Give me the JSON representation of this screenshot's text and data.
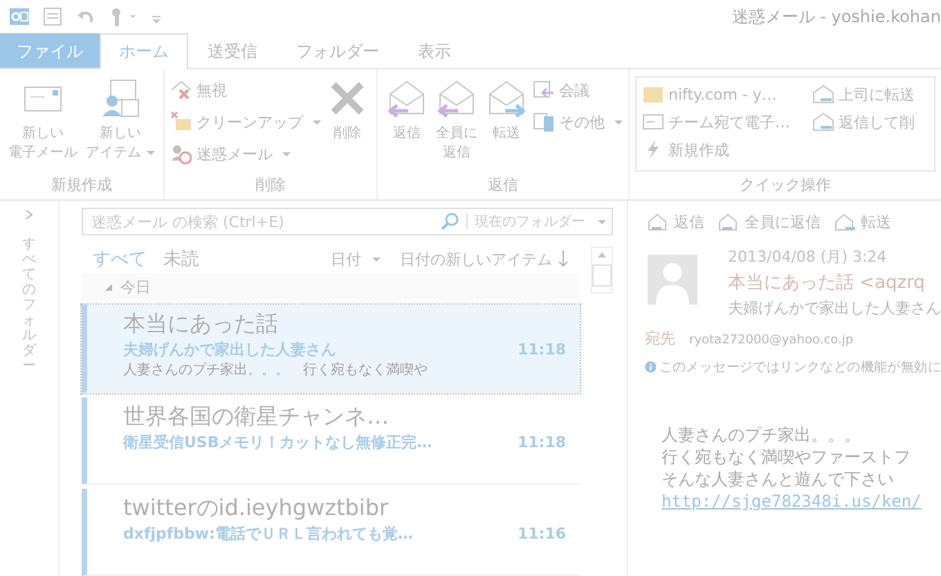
{
  "title_bar": {
    "title": "迷惑メール - yoshie.kohan"
  },
  "tabs": [
    {
      "label": "ファイル",
      "kind": "file",
      "selected": false
    },
    {
      "label": "ホーム",
      "kind": "tab",
      "selected": true
    },
    {
      "label": "送受信",
      "kind": "tab",
      "selected": false
    },
    {
      "label": "フォルダー",
      "kind": "tab",
      "selected": false
    },
    {
      "label": "表示",
      "kind": "tab",
      "selected": false
    }
  ],
  "ribbon": [
    {
      "label": "新規作成",
      "items": [
        {
          "kind": "large",
          "lines": [
            "新しい",
            "電子メール"
          ],
          "dropdown": false
        },
        {
          "kind": "large",
          "lines": [
            "新しい",
            "アイテム"
          ],
          "dropdown": true
        }
      ]
    },
    {
      "label": "削除",
      "items": [
        {
          "kind": "stack",
          "buttons": [
            {
              "label": "無視",
              "dropdown": false
            },
            {
              "label": "クリーンアップ",
              "dropdown": true
            },
            {
              "label": "迷惑メール",
              "dropdown": true
            }
          ]
        },
        {
          "kind": "large",
          "lines": [
            "削除"
          ],
          "dropdown": false
        }
      ]
    },
    {
      "label": "返信",
      "items": [
        {
          "kind": "large",
          "lines": [
            "返信"
          ],
          "dropdown": false
        },
        {
          "kind": "large",
          "lines": [
            "全員に",
            "返信"
          ],
          "dropdown": false
        },
        {
          "kind": "large",
          "lines": [
            "転送"
          ],
          "dropdown": false
        },
        {
          "kind": "stack",
          "buttons": [
            {
              "label": "会議",
              "dropdown": false
            },
            {
              "label": "その他",
              "dropdown": true
            }
          ]
        }
      ]
    },
    {
      "label": "クイック操作",
      "items": [
        {
          "kind": "gallery",
          "buttons": [
            {
              "label": "nifty.com - y…",
              "dropdown": false
            },
            {
              "label": "チーム宛て電子…",
              "dropdown": false
            },
            {
              "label": "新規作成",
              "dropdown": false
            },
            {
              "label": "上司に転送",
              "dropdown": false
            },
            {
              "label": "返信して削",
              "dropdown": false
            }
          ]
        }
      ]
    }
  ],
  "folder_pane": {
    "label": "すべてのフォルダー"
  },
  "search": {
    "placeholder": "迷惑メール の検索 (Ctrl+E)",
    "scope": "現在のフォルダー"
  },
  "filters": [
    {
      "label": "すべて",
      "selected": true
    },
    {
      "label": "未読",
      "selected": false
    }
  ],
  "sort": {
    "field": "日付",
    "order": "日付の新しいアイテム"
  },
  "group_header": "今日",
  "messages": [
    {
      "subject": "本当にあった話",
      "sender": "夫婦げんかで家出した人妻さん",
      "preview": "人妻さんのプチ家出。。。　行く宛もなく満喫や",
      "time": "11:18",
      "selected": true,
      "unread": true
    },
    {
      "subject": "世界各国の衛星チャンネ…",
      "sender": "衛星受信USBメモリ！カットなし無修正完…",
      "time": "11:18",
      "selected": false,
      "unread": true
    },
    {
      "subject": "twitterのid.ieyhgwztbibr",
      "sender": "dxfjpfbbw:電話でＵＲＬ言われても覚…",
      "time": "11:16",
      "selected": false,
      "unread": true
    }
  ],
  "reading": {
    "actions": [
      "返信",
      "全員に返信",
      "転送"
    ],
    "date": "2013/04/08 (月) 3:24",
    "from": "本当にあった話 <aqzrq",
    "subject": "夫婦げんかで家出した人妻さん",
    "to_label": "宛先",
    "to": "ryota272000@yahoo.co.jp",
    "info": "このメッセージではリンクなどの機能が無効に",
    "body": [
      "人妻さんのプチ家出。。。",
      "行く宛もなく満喫やファーストフ",
      "そんな人妻さんと遊んで下さい"
    ],
    "link": "http://sjge782348i.us/ken/"
  }
}
